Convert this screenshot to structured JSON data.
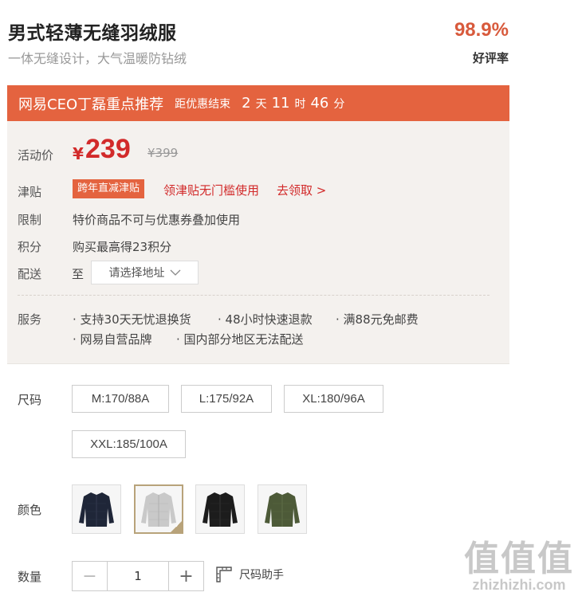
{
  "product": {
    "title": "男式轻薄无缝羽绒服",
    "subtitle": "一体无缝设计，大气温暖防钻绒",
    "rating": "98.9%",
    "rating_label": "好评率"
  },
  "promo_banner": {
    "title": "网易CEO丁磊重点推荐",
    "countdown_label": "距优惠结束",
    "days": "2",
    "days_unit": "天",
    "hours": "11",
    "hours_unit": "时",
    "minutes": "46",
    "minutes_unit": "分"
  },
  "price": {
    "label": "活动价",
    "currency": "¥",
    "current": "239",
    "original": "¥399"
  },
  "subsidy": {
    "label": "津贴",
    "tag": "跨年直减津贴",
    "text": "领津贴无门槛使用",
    "link": "去领取 >"
  },
  "limit": {
    "label": "限制",
    "text": "特价商品不可与优惠券叠加使用"
  },
  "points": {
    "label": "积分",
    "text": "购买最高得23积分"
  },
  "delivery": {
    "label": "配送",
    "to": "至",
    "placeholder": "请选择地址"
  },
  "services": {
    "label": "服务",
    "items": [
      "支持30天无忧退换货",
      "48小时快速退款",
      "满88元免邮费",
      "网易自营品牌",
      "国内部分地区无法配送"
    ]
  },
  "size": {
    "label": "尺码",
    "options": [
      "M:170/88A",
      "L:175/92A",
      "XL:180/96A",
      "XXL:185/100A"
    ]
  },
  "color": {
    "label": "颜色",
    "options": [
      {
        "name": "navy",
        "hex": "#1f2638"
      },
      {
        "name": "light-gray",
        "hex": "#c9c9c9"
      },
      {
        "name": "black",
        "hex": "#1c1c1c"
      },
      {
        "name": "olive-green",
        "hex": "#4d5a38"
      }
    ],
    "selected_index": 1
  },
  "quantity": {
    "label": "数量",
    "value": "1",
    "minus": "−",
    "plus": "+",
    "size_help": "尺码助手"
  },
  "watermark": {
    "big": "值值值",
    "small": "zhizhizhi.com"
  }
}
